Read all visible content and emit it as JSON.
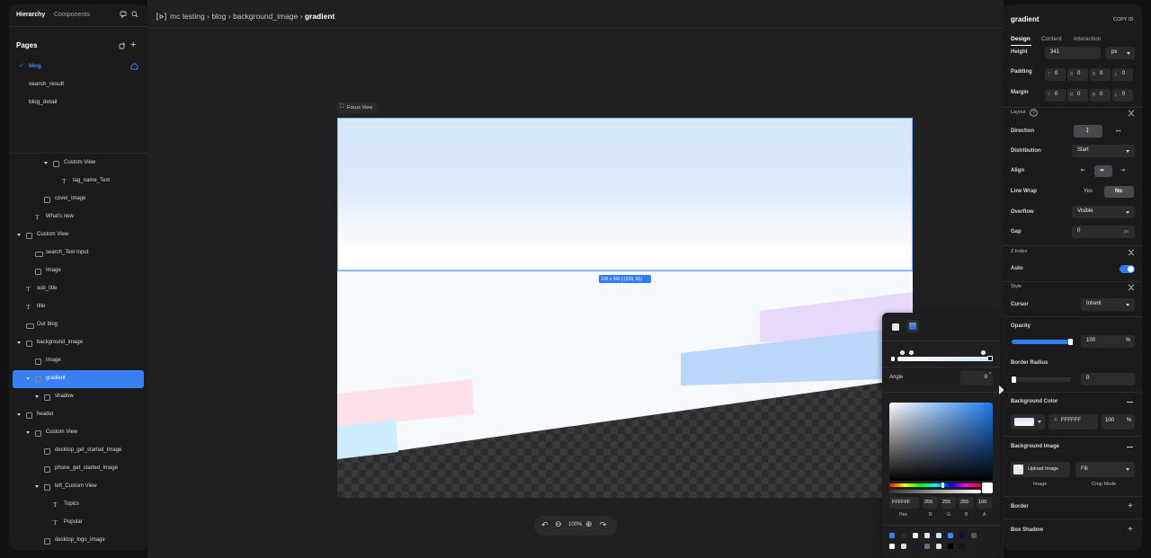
{
  "left_panel": {
    "tabs": [
      "Hierarchy",
      "Components"
    ],
    "pages_title": "Pages",
    "pages": [
      "blog",
      "search_result",
      "blog_detail"
    ],
    "tree": [
      {
        "label": "Custom View",
        "type": "view"
      },
      {
        "label": "tag_name_Text",
        "type": "text"
      },
      {
        "label": "cover_image",
        "type": "image"
      },
      {
        "label": "What's new",
        "type": "text"
      },
      {
        "label": "Custom View",
        "type": "view"
      },
      {
        "label": "search_Text Input",
        "type": "input"
      },
      {
        "label": "Image",
        "type": "image"
      },
      {
        "label": "sub_title",
        "type": "text"
      },
      {
        "label": "title",
        "type": "text"
      },
      {
        "label": "Our blog",
        "type": "component"
      },
      {
        "label": "background_image",
        "type": "view"
      },
      {
        "label": "Image",
        "type": "image"
      },
      {
        "label": "gradient",
        "type": "view"
      },
      {
        "label": "shadow",
        "type": "view"
      },
      {
        "label": "header",
        "type": "view"
      },
      {
        "label": "Custom View",
        "type": "view"
      },
      {
        "label": "desktop_get_started_Image",
        "type": "image"
      },
      {
        "label": "phone_get_started_Image",
        "type": "image"
      },
      {
        "label": "left_Custom View",
        "type": "view"
      },
      {
        "label": "Topics",
        "type": "text"
      },
      {
        "label": "Popular",
        "type": "text"
      },
      {
        "label": "desktop_logo_Image",
        "type": "image"
      }
    ]
  },
  "breadcrumb": {
    "parts": [
      "mc testing",
      "blog",
      "background_image"
    ],
    "current": "gradient"
  },
  "canvas": {
    "focus_view": "Focus View",
    "size_badge": "100 x 341 | (239, 81)",
    "zoom": "100%"
  },
  "color_picker": {
    "angle_label": "Angle",
    "angle_value": "0",
    "angle_unit": "°",
    "hex": "FFFFFF",
    "r": "255",
    "g": "255",
    "b": "255",
    "a": "100",
    "labels": [
      "Hex",
      "R",
      "G",
      "B",
      "A"
    ]
  },
  "right_panel": {
    "title": "gradient",
    "copy_id": "COPY ID",
    "tabs": [
      "Design",
      "Content",
      "Interaction"
    ],
    "height_label": "Height",
    "height_value": "341",
    "height_unit": "px",
    "padding_label": "Padding",
    "margin_label": "Margin",
    "box_letters": [
      "T",
      "R",
      "B",
      "L"
    ],
    "box_value": "0",
    "layout_section": "Layout",
    "direction_label": "Direction",
    "distribution_label": "Distribution",
    "distribution_value": "Start",
    "align_label": "Align",
    "linewrap_label": "Line Wrap",
    "linewrap_yes": "Yes",
    "linewrap_no": "No",
    "overflow_label": "Overflow",
    "overflow_value": "Visible",
    "gap_label": "Gap",
    "gap_value": "0",
    "gap_unit": "px",
    "zindex_section": "Z Index",
    "auto_label": "Auto",
    "style_section": "Style",
    "cursor_label": "Cursor",
    "cursor_value": "Inherit",
    "opacity_label": "Opacity",
    "opacity_value": "100",
    "opacity_level": 1.0,
    "percent": "%",
    "radius_label": "Border Radius",
    "radius_value": "0",
    "bgcolor_label": "Background Color",
    "bgcolor_hash": "#",
    "bgcolor_hex": "FFFFFF",
    "bgcolor_alpha": "100",
    "bgimage_label": "Background Image",
    "upload_label": "Upload Image",
    "fill_value": "Fill",
    "image_caption": "Image",
    "crop_caption": "Crop Mode",
    "border_label": "Border",
    "shadow_label": "Box Shadow"
  },
  "colors": {
    "accent": "#2f7cf6",
    "selected_row": "#3b7ff5"
  }
}
